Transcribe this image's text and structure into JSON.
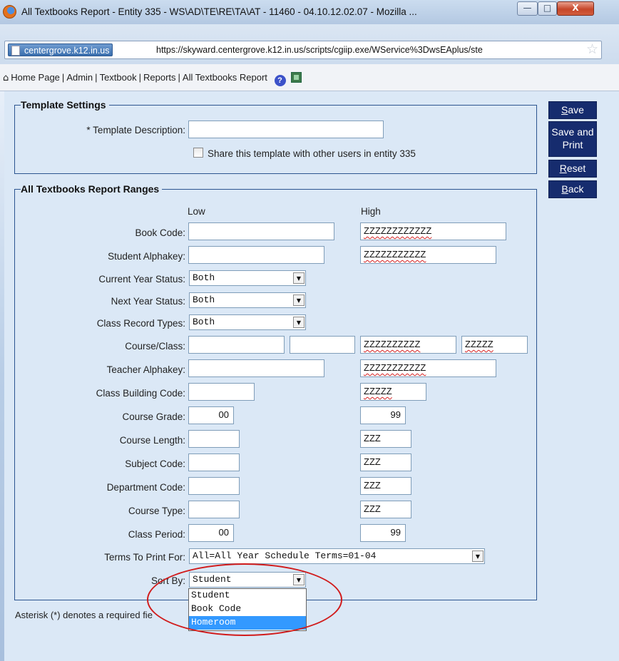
{
  "window": {
    "title": "All Textbooks Report - Entity 335 - WS\\AD\\TE\\RE\\TA\\AT - 11460 - 04.10.12.02.07 - Mozilla ...",
    "minimize_glyph": "—",
    "maximize_glyph": "□",
    "close_glyph": "X"
  },
  "address_bar": {
    "site_identity": "centergrove.k12.in.us",
    "url": "https://skyward.centergrove.k12.in.us/scripts/cgiip.exe/WService%3DwsEAplus/ste",
    "bookmark_glyph": "☆"
  },
  "breadcrumb": {
    "home_glyph": "⌂",
    "items": [
      "Home Page",
      "Admin",
      "Textbook",
      "Reports",
      "All Textbooks Report"
    ],
    "separator": "|",
    "help_glyph": "?"
  },
  "template_settings": {
    "legend": "Template Settings",
    "description_label": "* Template Description:",
    "description_value": "",
    "share_label": "Share this template with other users in entity 335",
    "share_checked": false
  },
  "ranges": {
    "legend": "All Textbooks Report Ranges",
    "low_header": "Low",
    "high_header": "High",
    "book_code": {
      "label": "Book Code:",
      "low": "",
      "high": "ZZZZZZZZZZZZ"
    },
    "student_alphakey": {
      "label": "Student Alphakey:",
      "low": "",
      "high": "ZZZZZZZZZZZ"
    },
    "current_year_status": {
      "label": "Current Year Status:",
      "value": "Both"
    },
    "next_year_status": {
      "label": "Next Year Status:",
      "value": "Both"
    },
    "class_record_types": {
      "label": "Class Record Types:",
      "value": "Both"
    },
    "course_class": {
      "label": "Course/Class:",
      "low_course": "",
      "low_class": "",
      "high_course": "ZZZZZZZZZZ",
      "high_class": "ZZZZZ"
    },
    "teacher_alphakey": {
      "label": "Teacher Alphakey:",
      "low": "",
      "high": "ZZZZZZZZZZZ"
    },
    "class_building_code": {
      "label": "Class Building Code:",
      "low": "",
      "high": "ZZZZZ"
    },
    "course_grade": {
      "label": "Course Grade:",
      "low": "00",
      "high": "99"
    },
    "course_length": {
      "label": "Course Length:",
      "low": "",
      "high": "ZZZ"
    },
    "subject_code": {
      "label": "Subject Code:",
      "low": "",
      "high": "ZZZ"
    },
    "department_code": {
      "label": "Department Code:",
      "low": "",
      "high": "ZZZ"
    },
    "course_type": {
      "label": "Course Type:",
      "low": "",
      "high": "ZZZ"
    },
    "class_period": {
      "label": "Class Period:",
      "low": "00",
      "high": "99"
    },
    "terms_to_print": {
      "label": "Terms To Print For:",
      "value": "All=All Year Schedule Terms=01-04"
    },
    "sort_by": {
      "label": "Sort By:",
      "value": "Student",
      "options": [
        "Student",
        "Book Code",
        "Homeroom"
      ],
      "highlighted": "Homeroom"
    }
  },
  "buttons": {
    "save_underlined": "S",
    "save_rest": "ave",
    "save_print_line1": "Save and",
    "save_print_line2": "Print",
    "reset_underlined": "R",
    "reset_rest": "eset",
    "back_underlined": "B",
    "back_rest": "ack"
  },
  "footnote": "Asterisk (*) denotes a required fie",
  "colors": {
    "button_bg": "#162c6e",
    "fieldset_border": "#2c5590",
    "page_bg": "#dbe8f6",
    "callout": "#d11b1b",
    "highlight": "#3399ff"
  }
}
